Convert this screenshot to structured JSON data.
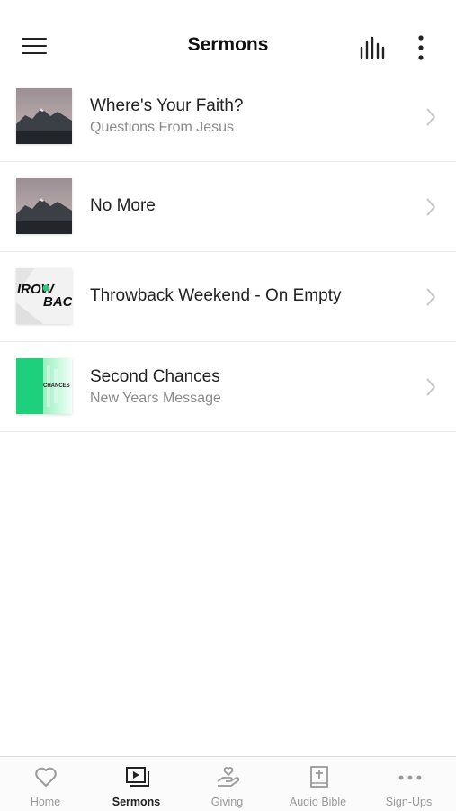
{
  "header": {
    "title": "Sermons"
  },
  "sermons": [
    {
      "title": "Where's Your Faith?",
      "subtitle": "Questions From Jesus",
      "thumb": "mountain"
    },
    {
      "title": "No More",
      "subtitle": "",
      "thumb": "mountain"
    },
    {
      "title": "Throwback Weekend - On Empty",
      "subtitle": "",
      "thumb": "throwback",
      "thumb_text": [
        "IROW",
        "BAC"
      ]
    },
    {
      "title": "Second Chances",
      "subtitle": "New Years Message",
      "thumb": "second-chances",
      "thumb_text": "CHANCES"
    }
  ],
  "tabs": [
    {
      "label": "Home",
      "icon": "heart-icon",
      "active": false
    },
    {
      "label": "Sermons",
      "icon": "video-library-icon",
      "active": true
    },
    {
      "label": "Giving",
      "icon": "giving-hand-icon",
      "active": false
    },
    {
      "label": "Audio Bible",
      "icon": "bible-icon",
      "active": false
    },
    {
      "label": "Sign-Ups",
      "icon": "more-dots-icon",
      "active": false
    }
  ],
  "colors": {
    "accent": "#222222",
    "inactive": "#999999",
    "subtitle": "#8a8a8a",
    "green": "#21d07a"
  }
}
